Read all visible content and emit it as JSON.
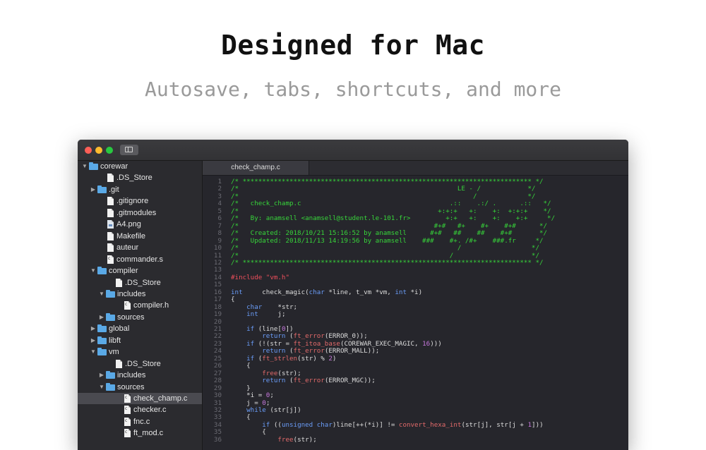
{
  "hero": {
    "title": "Designed for Mac",
    "subtitle": "Autosave, tabs, shortcuts, and more"
  },
  "colors": {
    "comment": "#37d43a",
    "keyword": "#6a9cf7",
    "function": "#e26a6a",
    "number": "#c678dd",
    "preprocessor": "#ef4f5c",
    "folder": "#5aa9e6",
    "editor_bg": "#26262c",
    "sidebar_bg": "#2b2b2f"
  },
  "window": {
    "traffic_lights": [
      "close",
      "minimize",
      "zoom"
    ]
  },
  "sidebar": {
    "items": [
      {
        "label": "corewar",
        "type": "folder",
        "depth": 0,
        "expanded": true
      },
      {
        "label": ".DS_Store",
        "type": "file",
        "depth": 1
      },
      {
        "label": ".git",
        "type": "folder",
        "depth": 1,
        "expanded": false
      },
      {
        "label": ".gitignore",
        "type": "file",
        "depth": 1
      },
      {
        "label": ".gitmodules",
        "type": "file",
        "depth": 1
      },
      {
        "label": "A4.png",
        "type": "image",
        "depth": 1
      },
      {
        "label": "Makefile",
        "type": "file",
        "depth": 1
      },
      {
        "label": "auteur",
        "type": "file",
        "depth": 1
      },
      {
        "label": "commander.s",
        "type": "source",
        "depth": 1
      },
      {
        "label": "compiler",
        "type": "folder",
        "depth": 1,
        "expanded": true
      },
      {
        "label": ".DS_Store",
        "type": "file",
        "depth": 2
      },
      {
        "label": "includes",
        "type": "folder",
        "depth": 2,
        "expanded": true
      },
      {
        "label": "compiler.h",
        "type": "source",
        "depth": 3
      },
      {
        "label": "sources",
        "type": "folder",
        "depth": 2,
        "expanded": false
      },
      {
        "label": "global",
        "type": "folder",
        "depth": 1,
        "expanded": false
      },
      {
        "label": "libft",
        "type": "folder",
        "depth": 1,
        "expanded": false
      },
      {
        "label": "vm",
        "type": "folder",
        "depth": 1,
        "expanded": true
      },
      {
        "label": ".DS_Store",
        "type": "file",
        "depth": 2
      },
      {
        "label": "includes",
        "type": "folder",
        "depth": 2,
        "expanded": false
      },
      {
        "label": "sources",
        "type": "folder",
        "depth": 2,
        "expanded": true
      },
      {
        "label": "check_champ.c",
        "type": "source",
        "depth": 3,
        "selected": true
      },
      {
        "label": "checker.c",
        "type": "source",
        "depth": 3
      },
      {
        "label": "fnc.c",
        "type": "source",
        "depth": 3
      },
      {
        "label": "ft_mod.c",
        "type": "source",
        "depth": 3
      }
    ]
  },
  "tabs": [
    {
      "label": "check_champ.c",
      "active": true
    }
  ],
  "code": {
    "lines": [
      [
        [
          "c",
          "/* ************************************************************************** */"
        ]
      ],
      [
        [
          "c",
          "/*                                                        LE - /            */"
        ]
      ],
      [
        [
          "c",
          "/*                                                            /             */"
        ]
      ],
      [
        [
          "c",
          "/*   check_champ.c                                      .::    .:/ .      .::   */"
        ]
      ],
      [
        [
          "c",
          "/*                                                   +:+:+   +:    +:  +:+:+    */"
        ]
      ],
      [
        [
          "c",
          "/*   By: anamsell <anamsell@student.le-101.fr>         +:+   +:    +:    +:+     */"
        ]
      ],
      [
        [
          "c",
          "/*                                                  #+#   #+    #+    #+#      */"
        ]
      ],
      [
        [
          "c",
          "/*   Created: 2018/10/21 15:16:52 by anamsell      #+#   ##    ##    #+#       */"
        ]
      ],
      [
        [
          "c",
          "/*   Updated: 2018/11/13 14:19:56 by anamsell    ###    #+. /#+    ###.fr     */"
        ]
      ],
      [
        [
          "c",
          "/*                                                        /                  */"
        ]
      ],
      [
        [
          "c",
          "/*                                                      /                    */"
        ]
      ],
      [
        [
          "c",
          "/* ************************************************************************** */"
        ]
      ],
      [],
      [
        [
          "p",
          "#include \"vm.h\""
        ]
      ],
      [],
      [
        [
          "k",
          "int"
        ],
        [
          "t",
          "     check_magic("
        ],
        [
          "k",
          "char"
        ],
        [
          "t",
          " *line, t_vm *vm, "
        ],
        [
          "k",
          "int"
        ],
        [
          "t",
          " *i)"
        ]
      ],
      [
        [
          "t",
          "{"
        ]
      ],
      [
        [
          "t",
          "    "
        ],
        [
          "k",
          "char"
        ],
        [
          "t",
          "    *str;"
        ]
      ],
      [
        [
          "t",
          "    "
        ],
        [
          "k",
          "int"
        ],
        [
          "t",
          "     j;"
        ]
      ],
      [],
      [
        [
          "t",
          "    "
        ],
        [
          "k",
          "if"
        ],
        [
          "t",
          " (line["
        ],
        [
          "n",
          "0"
        ],
        [
          "t",
          "])"
        ]
      ],
      [
        [
          "t",
          "        "
        ],
        [
          "k",
          "return"
        ],
        [
          "t",
          " ("
        ],
        [
          "f",
          "ft_error"
        ],
        [
          "t",
          "(ERROR_0));"
        ]
      ],
      [
        [
          "t",
          "    "
        ],
        [
          "k",
          "if"
        ],
        [
          "t",
          " (!(str = "
        ],
        [
          "f",
          "ft_itoa_base"
        ],
        [
          "t",
          "(COREWAR_EXEC_MAGIC, "
        ],
        [
          "n",
          "16"
        ],
        [
          "t",
          ")))"
        ]
      ],
      [
        [
          "t",
          "        "
        ],
        [
          "k",
          "return"
        ],
        [
          "t",
          " ("
        ],
        [
          "f",
          "ft_error"
        ],
        [
          "t",
          "(ERROR_MALL));"
        ]
      ],
      [
        [
          "t",
          "    "
        ],
        [
          "k",
          "if"
        ],
        [
          "t",
          " ("
        ],
        [
          "f",
          "ft_strlen"
        ],
        [
          "t",
          "(str) % "
        ],
        [
          "n",
          "2"
        ],
        [
          "t",
          ")"
        ]
      ],
      [
        [
          "t",
          "    {"
        ]
      ],
      [
        [
          "t",
          "        "
        ],
        [
          "f",
          "free"
        ],
        [
          "t",
          "(str);"
        ]
      ],
      [
        [
          "t",
          "        "
        ],
        [
          "k",
          "return"
        ],
        [
          "t",
          " ("
        ],
        [
          "f",
          "ft_error"
        ],
        [
          "t",
          "(ERROR_MGC));"
        ]
      ],
      [
        [
          "t",
          "    }"
        ]
      ],
      [
        [
          "t",
          "    *i = "
        ],
        [
          "n",
          "0"
        ],
        [
          "t",
          ";"
        ]
      ],
      [
        [
          "t",
          "    j = "
        ],
        [
          "n",
          "0"
        ],
        [
          "t",
          ";"
        ]
      ],
      [
        [
          "t",
          "    "
        ],
        [
          "k",
          "while"
        ],
        [
          "t",
          " (str[j])"
        ]
      ],
      [
        [
          "t",
          "    {"
        ]
      ],
      [
        [
          "t",
          "        "
        ],
        [
          "k",
          "if"
        ],
        [
          "t",
          " (("
        ],
        [
          "k",
          "unsigned char"
        ],
        [
          "t",
          ")line[++(*i)] != "
        ],
        [
          "f",
          "convert_hexa_int"
        ],
        [
          "t",
          "(str[j], str[j + "
        ],
        [
          "n",
          "1"
        ],
        [
          "t",
          "]))"
        ]
      ],
      [
        [
          "t",
          "        {"
        ]
      ],
      [
        [
          "t",
          "            "
        ],
        [
          "f",
          "free"
        ],
        [
          "t",
          "(str);"
        ]
      ]
    ]
  }
}
